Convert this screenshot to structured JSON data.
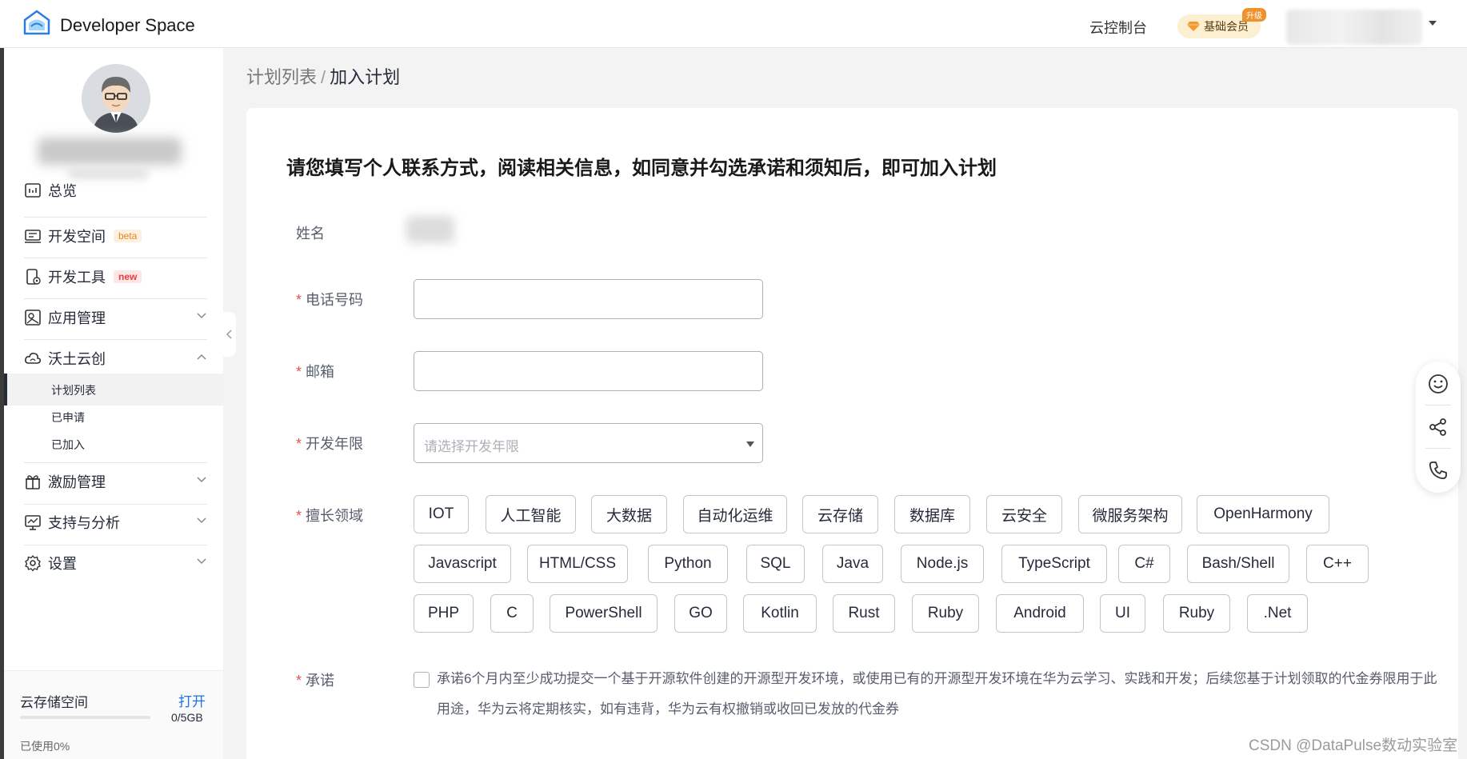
{
  "header": {
    "brand": "Developer Space",
    "console": "云控制台",
    "member_badge": "基础会员",
    "upgrade_tag": "升级"
  },
  "sidebar": {
    "items": [
      {
        "label": "总览",
        "icon": "dashboard-icon"
      },
      {
        "label": "开发空间",
        "icon": "dev-space-icon",
        "tag": "beta"
      },
      {
        "label": "开发工具",
        "icon": "dev-tools-icon",
        "tag": "new"
      },
      {
        "label": "应用管理",
        "icon": "app-management-icon"
      },
      {
        "label": "沃土云创",
        "icon": "cloud-icon",
        "expanded": true
      },
      {
        "label": "激励管理",
        "icon": "gift-icon"
      },
      {
        "label": "支持与分析",
        "icon": "support-icon"
      },
      {
        "label": "设置",
        "icon": "gear-icon"
      }
    ],
    "subitems": [
      "计划列表",
      "已申请",
      "已加入"
    ],
    "active_subitem": "计划列表",
    "storage": {
      "title": "云存储空间",
      "open": "打开",
      "size": "0/5GB",
      "used": "已使用0%",
      "used_fraction": 0
    }
  },
  "breadcrumb": {
    "parent": "计划列表",
    "separator": "/",
    "current": "加入计划"
  },
  "form": {
    "title": "请您填写个人联系方式，阅读相关信息，如同意并勾选承诺和须知后，即可加入计划",
    "required_mark": "*",
    "name_label": "姓名",
    "phone_label": "电话号码",
    "phone_value": "",
    "email_label": "邮箱",
    "email_value": "",
    "years_label": "开发年限",
    "years_placeholder": "请选择开发年限",
    "domain_label": "擅长领域",
    "chips": [
      [
        "IOT",
        "人工智能",
        "大数据",
        "自动化运维",
        "云存储",
        "数据库",
        "云安全",
        "微服务架构",
        "OpenHarmony"
      ],
      [
        "Javascript",
        "HTML/CSS",
        "Python",
        "SQL",
        "Java",
        "Node.js",
        "TypeScript",
        "C#",
        "Bash/Shell",
        "C++"
      ],
      [
        "PHP",
        "C",
        "PowerShell",
        "GO",
        "Kotlin",
        "Rust",
        "Ruby",
        "Android",
        "UI",
        "Ruby",
        ".Net"
      ]
    ],
    "promise_label": "承诺",
    "promise_checked": false,
    "promise_text": "承诺6个月内至少成功提交一个基于开源软件创建的开源型开发环境，或使用已有的开源型开发环境在华为云学习、实践和开发；后续您基于计划领取的代金券限用于此用途，华为云将定期核实，如有违背，华为云有权撤销或收回已发放的代金券"
  },
  "float_tools": [
    "smile-icon",
    "share-icon",
    "phone-icon"
  ],
  "watermark": "CSDN @DataPulse数动实验室",
  "colors": {
    "link": "#1e72e6",
    "required": "#e05353",
    "badge_bg": "#fdefd2",
    "upgrade": "#f0922c"
  }
}
